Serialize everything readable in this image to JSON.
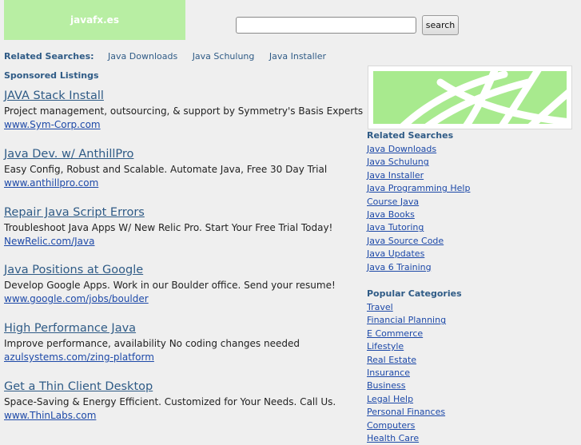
{
  "header": {
    "logo_text": "javafx.es",
    "search_placeholder": "",
    "search_button": "search"
  },
  "top_related": {
    "label": "Related Searches:",
    "links": [
      "Java Downloads",
      "Java Schulung",
      "Java Installer"
    ]
  },
  "sponsored_label": "Sponsored Listings",
  "ads": [
    {
      "title": "JAVA Stack Install",
      "desc": "Project management, outsourcing, & support by Symmetry's Basis Experts",
      "url": "www.Sym-Corp.com"
    },
    {
      "title": "Java Dev. w/ AnthillPro",
      "desc": "Easy Config, Robust and Scalable. Automate Java, Free 30 Day Trial",
      "url": "www.anthillpro.com"
    },
    {
      "title": "Repair Java Script Errors",
      "desc": "Troubleshoot Java Apps W/ New Relic Pro. Start Your Free Trial Today!",
      "url": "NewRelic.com/Java"
    },
    {
      "title": "Java Positions at Google",
      "desc": "Develop Google Apps. Work in our Boulder office. Send your resume!",
      "url": "www.google.com/jobs/boulder"
    },
    {
      "title": "High Performance Java",
      "desc": "Improve performance, availability No coding changes needed",
      "url": "azulsystems.com/zing-platform"
    },
    {
      "title": "Get a Thin Client Desktop",
      "desc": "Space-Saving & Energy Efficient. Customized for Your Needs. Call Us.",
      "url": "www.ThinLabs.com"
    }
  ],
  "sidebar": {
    "related_head": "Related Searches",
    "related_links": [
      "Java Downloads",
      "Java Schulung",
      "Java Installer",
      "Java Programming Help",
      "Course Java",
      "Java Books",
      "Java Tutoring",
      "Java Source Code",
      "Java Updates",
      "Java 6 Training"
    ],
    "popular_head": "Popular Categories",
    "popular_links": [
      "Travel",
      "Financial Planning",
      "E Commerce",
      "Lifestyle",
      "Real Estate",
      "Insurance",
      "Business",
      "Legal Help",
      "Personal Finances",
      "Computers",
      "Health Care"
    ]
  },
  "colors": {
    "background": "#efefef",
    "logo_bg": "#b8eea3",
    "banner_green": "#a8ea8e",
    "link_blue": "#1d49a8",
    "heading_blue": "#2f5b86"
  }
}
